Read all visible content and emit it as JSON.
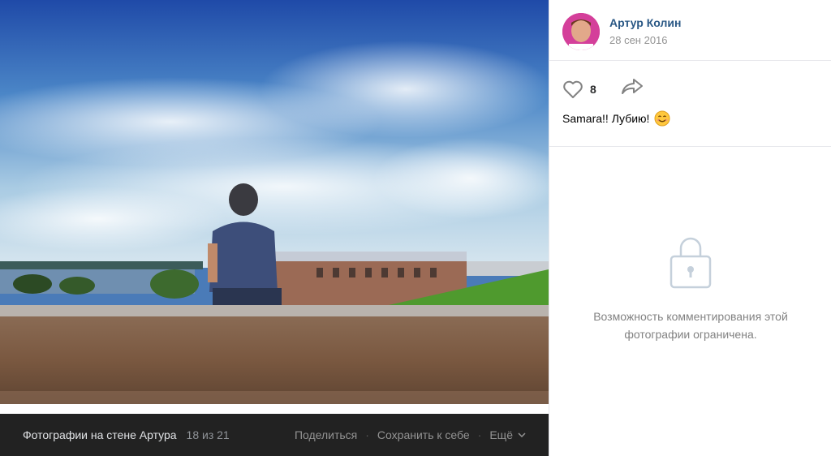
{
  "author": {
    "name": "Артур Колин",
    "date": "28 сен 2016"
  },
  "likes": {
    "count": "8"
  },
  "post": {
    "caption": "Samara!! Лубию!"
  },
  "comments": {
    "restricted_line1": "Возможность комментирования этой",
    "restricted_line2": "фотографии ограничена."
  },
  "bottom_bar": {
    "album_title": "Фотографии на стене Артура",
    "counter": "18 из 21",
    "share_label": "Поделиться",
    "save_label": "Сохранить к себе",
    "more_label": "Ещё"
  },
  "icons": {
    "like": "heart-icon",
    "share": "share-arrow-icon",
    "lock": "lock-icon",
    "more": "chevron-down-icon",
    "emoji": "smiling-face-emoji"
  },
  "colors": {
    "link": "#2a5885",
    "icon_gray": "#828282",
    "bar_bg": "#222222",
    "panel_bg": "#ffffff"
  }
}
